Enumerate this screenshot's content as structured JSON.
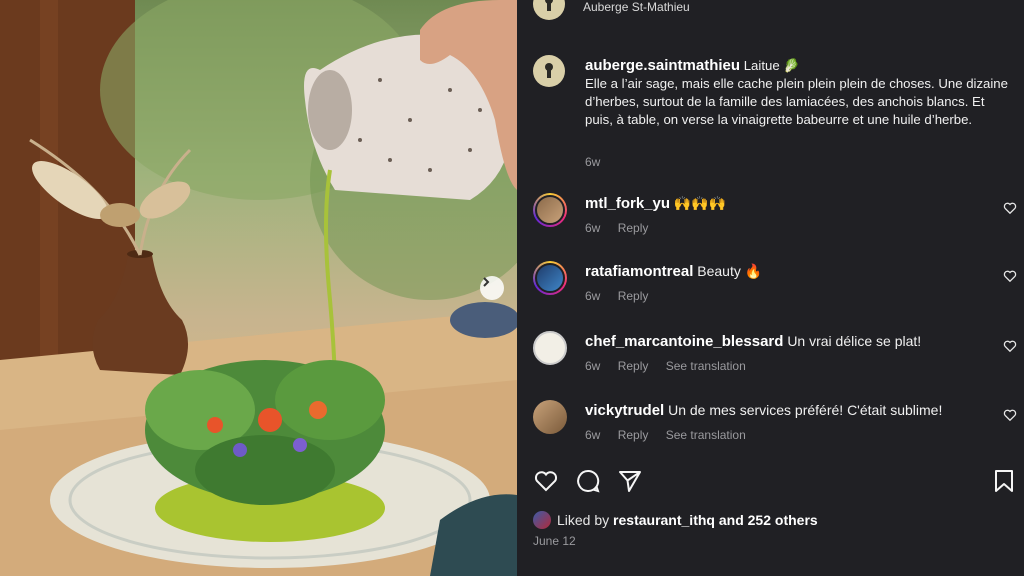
{
  "header": {
    "account_name": "Auberge St-Mathieu"
  },
  "post": {
    "username": "auberge.saintmathieu",
    "title_word": "Laitue",
    "title_emoji": "🥬",
    "text": "Elle a l’air sage, mais elle cache plein plein plein de choses. Une dizaine d’herbes, surtout de la famille des lamiacées, des anchois blancs. Et puis, à table, on verse la vinaigrette babeurre et une huile d’herbe.",
    "timestamp": "6w"
  },
  "comments": [
    {
      "username": "mtl_fork_yu",
      "text": "🙌🙌🙌",
      "time": "6w",
      "reply": "Reply",
      "translate": ""
    },
    {
      "username": "ratafiamontreal",
      "text": "Beauty 🔥",
      "time": "6w",
      "reply": "Reply",
      "translate": ""
    },
    {
      "username": "chef_marcantoine_blessard",
      "text": "Un vrai délice se plat!",
      "time": "6w",
      "reply": "Reply",
      "translate": "See translation"
    },
    {
      "username": "vickytrudel",
      "text": "Un de mes services préféré! C'était sublime!",
      "time": "6w",
      "reply": "Reply",
      "translate": "See translation"
    }
  ],
  "likes": {
    "prefix": "Liked by",
    "user": "restaurant_ithq",
    "suffix": "and 252 others"
  },
  "date": "June 12",
  "icons": [
    "heart-icon",
    "comment-icon",
    "share-icon",
    "bookmark-icon",
    "chevron-right-icon"
  ],
  "colors": {
    "panel_bg": "#202024",
    "muted_text": "#9a9a9e",
    "accent_green": "#6cc04a"
  }
}
